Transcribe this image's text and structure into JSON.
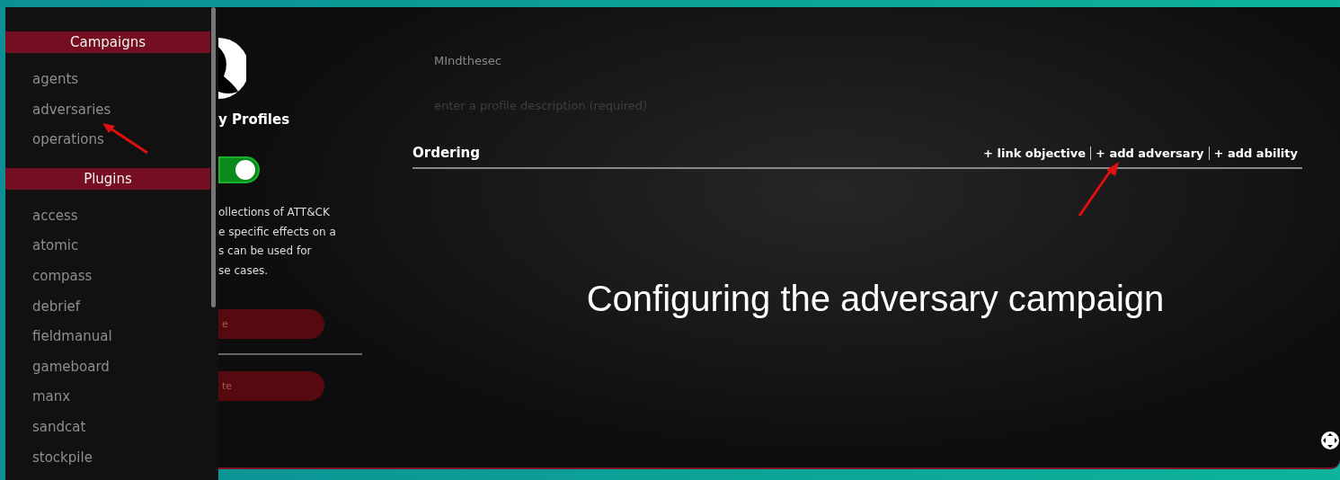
{
  "sidebar": {
    "sections": [
      {
        "title": "Campaigns",
        "items": [
          "agents",
          "adversaries",
          "operations"
        ]
      },
      {
        "title": "Plugins",
        "items": [
          "access",
          "atomic",
          "compass",
          "debrief",
          "fieldmanual",
          "gameboard",
          "manx",
          "sandcat",
          "stockpile"
        ]
      }
    ]
  },
  "profile_panel": {
    "title": "y Profiles",
    "toggle": {
      "on": true
    },
    "description": [
      "ollections of ATT&CK",
      "e specific effects on a",
      "s can be used for",
      "se cases."
    ],
    "buttons": [
      "e",
      "te"
    ]
  },
  "form": {
    "name_value": "MIndthesec",
    "description_placeholder": "enter a profile description (required)"
  },
  "ordering": {
    "title": "Ordering",
    "actions": [
      "+ link objective",
      "+ add adversary",
      "+ add ability"
    ]
  },
  "caption": "Configuring the adversary campaign"
}
